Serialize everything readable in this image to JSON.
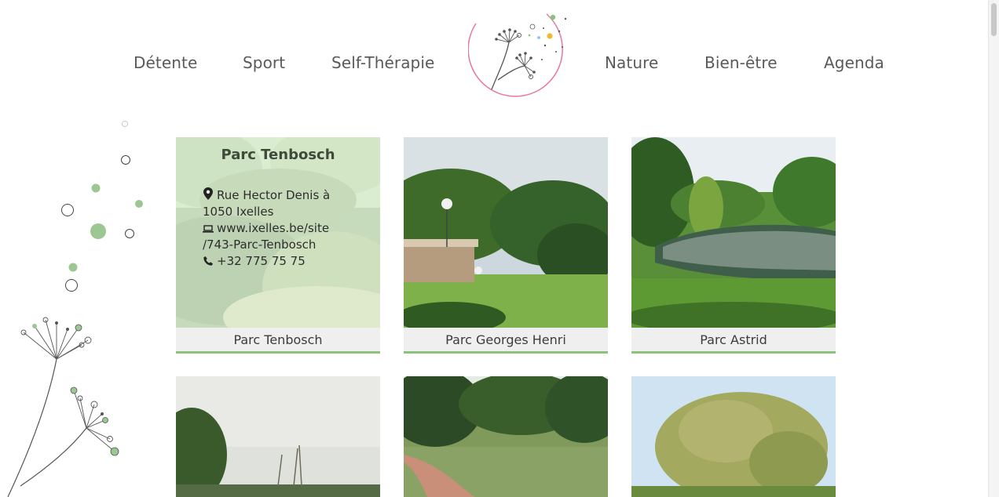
{
  "nav": {
    "left": [
      "Détente",
      "Sport",
      "Self-Thérapie"
    ],
    "right": [
      "Nature",
      "Bien-être",
      "Agenda"
    ]
  },
  "colors": {
    "accent_green": "#8cc37a",
    "logo_ring": "#e47aa0"
  },
  "cards": [
    {
      "caption": "Parc Tenbosch"
    },
    {
      "caption": "Parc Georges Henri"
    },
    {
      "caption": "Parc Astrid"
    }
  ],
  "featured": {
    "title": "Parc Tenbosch",
    "address_line1": "Rue Hector Denis à",
    "address_line2": "1050 Ixelles",
    "website_line1": "www.ixelles.be/site",
    "website_line2": "/743-Parc-Tenbosch",
    "phone": "+32 775 75 75",
    "icons": [
      "map-marker-icon",
      "laptop-icon",
      "phone-icon"
    ]
  }
}
